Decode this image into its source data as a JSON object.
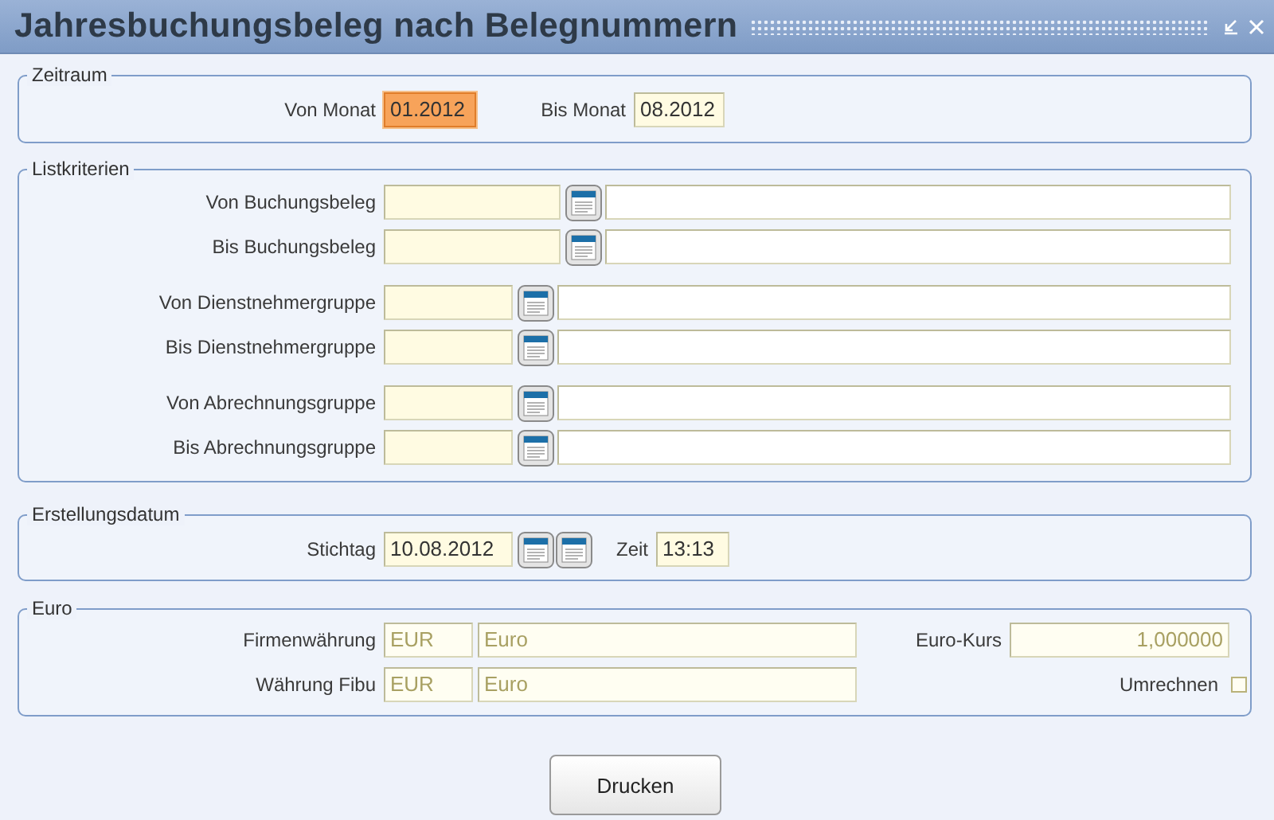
{
  "window": {
    "title": "Jahresbuchungsbeleg nach Belegnummern"
  },
  "period": {
    "title": "Zeitraum",
    "from": {
      "label": "Von Monat",
      "value": "01.2012",
      "focused": true
    },
    "to": {
      "label": "Bis Monat",
      "value": "08.2012",
      "focused": false
    }
  },
  "criteria": {
    "title": "Listkriterien",
    "groups": [
      {
        "kind": "wide",
        "rows": [
          {
            "label": "Von Buchungsbeleg"
          },
          {
            "label": "Bis Buchungsbeleg"
          }
        ]
      },
      {
        "kind": "narrow",
        "rows": [
          {
            "label": "Von Dienstnehmergruppe"
          },
          {
            "label": "Bis Dienstnehmergruppe"
          }
        ]
      },
      {
        "kind": "narrow",
        "rows": [
          {
            "label": "Von Abrechnungsgruppe"
          },
          {
            "label": "Bis Abrechnungsgruppe"
          }
        ]
      }
    ]
  },
  "creation": {
    "title": "Erstellungsdatum",
    "date_label": "Stichtag",
    "date": "10.08.2012",
    "time_label": "Zeit",
    "time": "13:13"
  },
  "euro": {
    "title": "Euro",
    "rows": [
      {
        "label": "Firmenwährung",
        "code": "EUR",
        "name": "Euro"
      },
      {
        "label": "Währung Fibu",
        "code": "EUR",
        "name": "Euro"
      }
    ],
    "rate_label": "Euro-Kurs",
    "rate": "1,000000",
    "convert": {
      "label": "Umrechnen",
      "checked": false
    }
  },
  "buttons": [
    "Drucken"
  ]
}
